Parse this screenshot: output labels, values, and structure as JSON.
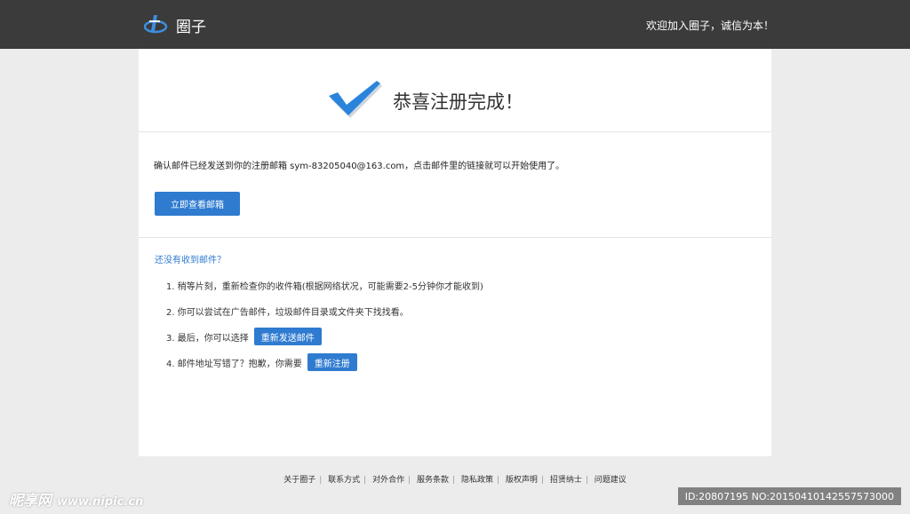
{
  "header": {
    "logo_icon": "circle-logo-icon",
    "site_name": "圈子",
    "welcome": "欢迎加入圈子，诚信为本！"
  },
  "success": {
    "icon": "checkmark-icon",
    "title": "恭喜注册完成！"
  },
  "confirm": {
    "text": "确认邮件已经发送到你的注册邮箱 sym-83205040@163.com，点击邮件里的链接就可以开始使用了。",
    "check_button": "立即查看邮箱"
  },
  "help": {
    "title": "还没有收到邮件？",
    "step1": "1. 稍等片刻，重新检查你的收件箱(根据网络状况，可能需要2-5分钟你才能收到)",
    "step2": "2. 你可以尝试在广告邮件，垃圾邮件目录或文件夹下找找看。",
    "step3": "3. 最后，你可以选择",
    "resend_button": "重新发送邮件",
    "step4": "4. 邮件地址写错了？抱歉，你需要",
    "reregister_button": "重新注册"
  },
  "footer": {
    "links": [
      "关于圈子",
      "联系方式",
      "对外合作",
      "服务条款",
      "隐私政策",
      "版权声明",
      "招贤纳士",
      "问题建议"
    ]
  },
  "watermark": {
    "site": "昵享网",
    "url": "www.nipic.cn",
    "id_text": "ID:20807195 NO:20150410142557573000"
  },
  "colors": {
    "topbar": "#3b3b3b",
    "accent": "#2f7bd0",
    "background": "#ececec"
  }
}
